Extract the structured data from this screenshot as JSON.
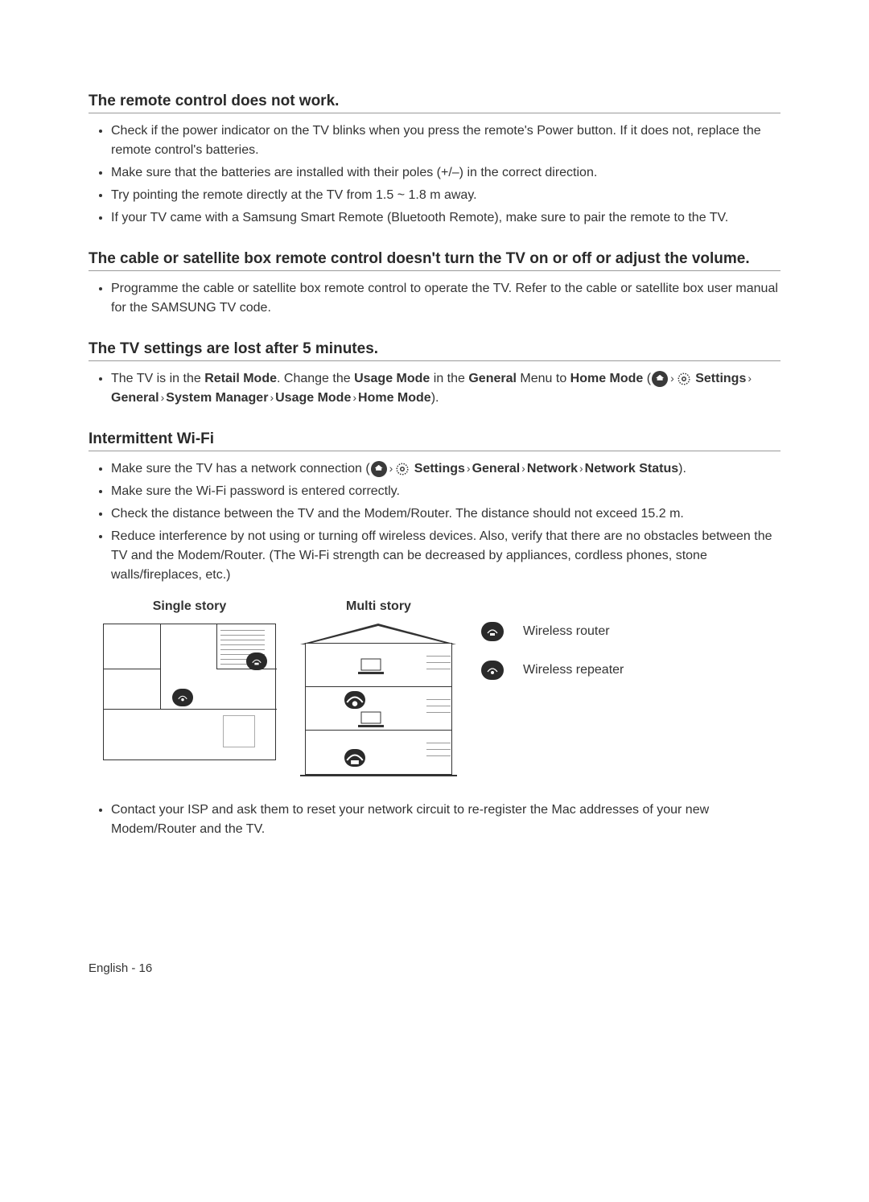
{
  "sections": [
    {
      "title": "The remote control does not work.",
      "items": [
        {
          "text": "Check if the power indicator on the TV blinks when you press the remote's Power button. If it does not, replace the remote control's batteries."
        },
        {
          "text": "Make sure that the batteries are installed with their poles (+/–) in the correct direction."
        },
        {
          "text": "Try pointing the remote directly at the TV from 1.5 ~ 1.8 m away."
        },
        {
          "text": "If your TV came with a Samsung Smart Remote (Bluetooth Remote), make sure to pair the remote to the TV."
        }
      ]
    },
    {
      "title": "The cable or satellite box remote control doesn't turn the TV on or off or adjust the volume.",
      "items": [
        {
          "text": "Programme the cable or satellite box remote control to operate the TV. Refer to the cable or satellite box user manual for the SAMSUNG TV code."
        }
      ]
    },
    {
      "title": "The TV settings are lost after 5 minutes."
    },
    {
      "title": "Intermittent Wi-Fi"
    }
  ],
  "retail": {
    "pre": "The TV is in the ",
    "retail_mode": "Retail Mode",
    "mid1": ". Change the ",
    "usage_mode": "Usage Mode",
    "mid2": " in the ",
    "general": "General",
    "mid3": " Menu to ",
    "home_mode": "Home Mode",
    "open": " (",
    "settings": "Settings",
    "path_general": "General",
    "path_sm": "System Manager",
    "path_um": "Usage Mode",
    "path_hm": "Home Mode",
    "close": ")."
  },
  "wifi": {
    "bullet1_pre": "Make sure the TV has a network connection (",
    "settings": "Settings",
    "general": "General",
    "network": "Network",
    "network_status": "Network Status",
    "close": ").",
    "bullet2": "Make sure the Wi-Fi password is entered correctly.",
    "bullet3": "Check the distance between the TV and the Modem/Router. The distance should not exceed 15.2 m.",
    "bullet4": "Reduce interference by not using or turning off wireless devices. Also, verify that there are no obstacles between the TV and the Modem/Router. (The Wi-Fi strength can be decreased by appliances, cordless phones, stone walls/fireplaces, etc.)",
    "bullet5": "Contact your ISP and ask them to reset your network circuit to re-register the Mac addresses of your new Modem/Router and the TV."
  },
  "diagrams": {
    "single": "Single story",
    "multi": "Multi story",
    "legend_router": "Wireless router",
    "legend_repeater": "Wireless repeater"
  },
  "footer": "English - 16"
}
